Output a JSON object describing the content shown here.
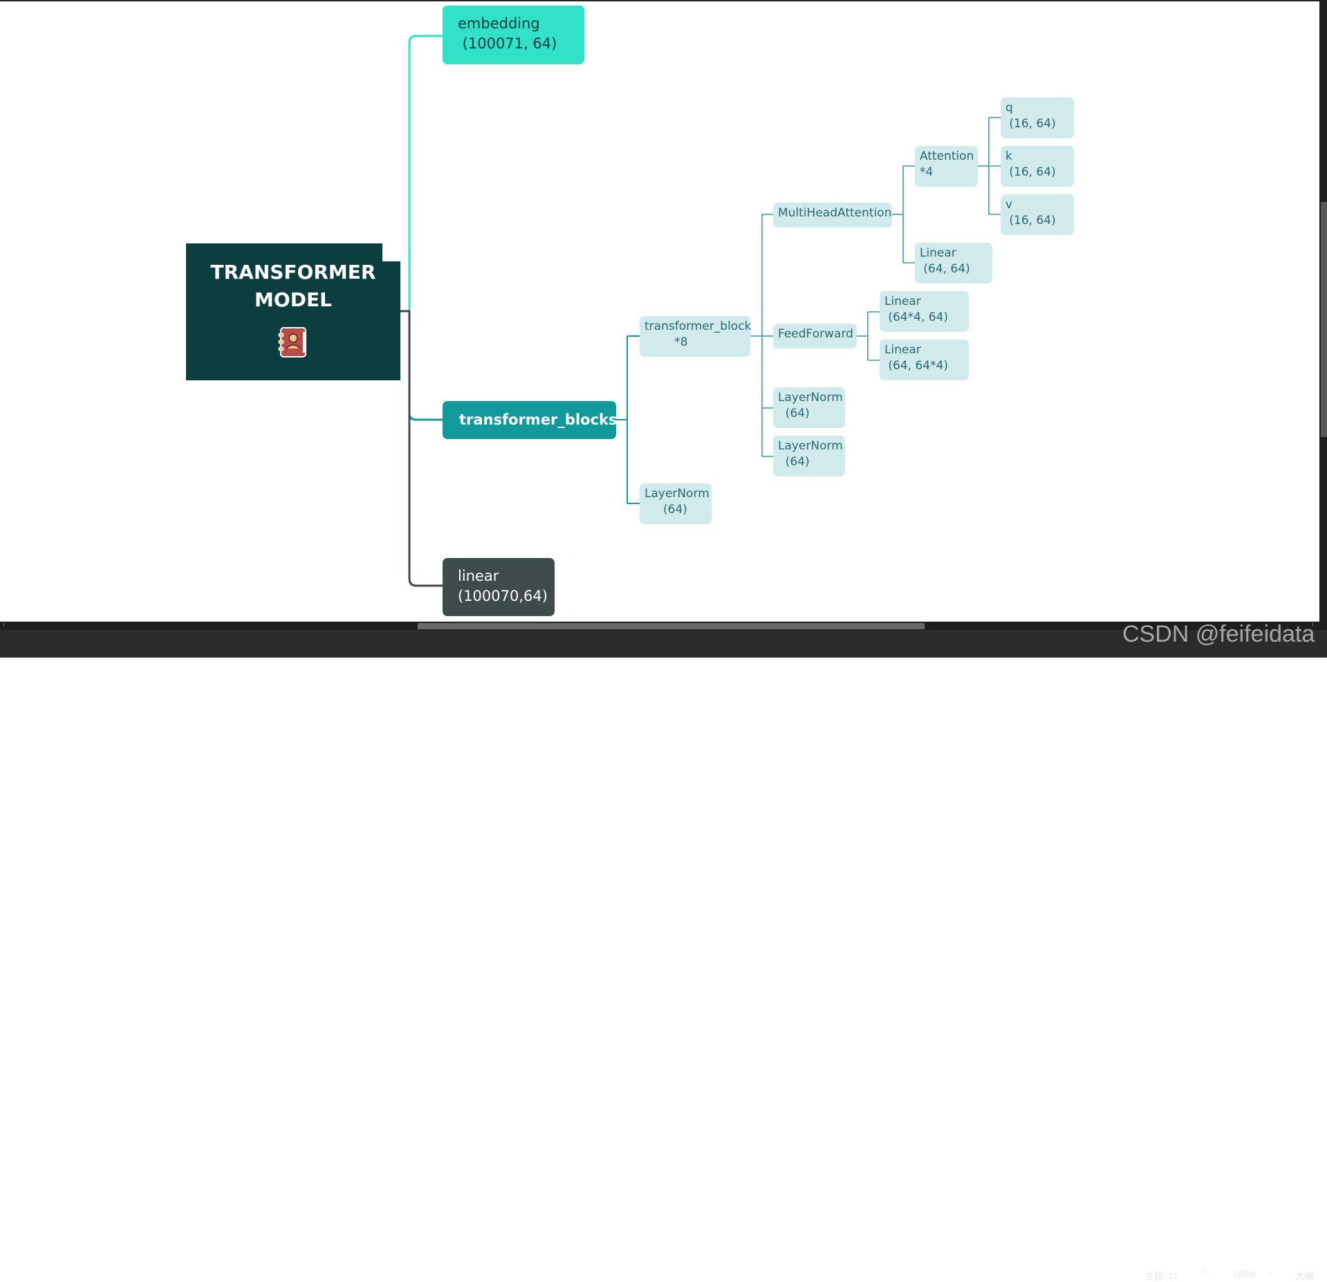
{
  "root": {
    "title": "TRANSFORMER\nMODEL",
    "icon": "address-book-icon"
  },
  "branches": {
    "embedding": {
      "label": "embedding\n (100071, 64)"
    },
    "transformer_blocks": {
      "label": "transformer_blocks"
    },
    "linear": {
      "label": "linear\n(100070,64)"
    }
  },
  "nodes": {
    "transformer_block": "transformer_block\n        *8",
    "final_layernorm": "LayerNorm\n     (64)",
    "multihead": "MultiHeadAttention",
    "feedforward": "FeedForward",
    "layernorm_1": "LayerNorm\n  (64)",
    "layernorm_2": "LayerNorm\n  (64)",
    "attention": "Attention\n*4",
    "attn_linear": "Linear\n (64, 64)",
    "ff_linear_1": "Linear\n (64*4, 64)",
    "ff_linear_2": "Linear\n (64, 64*4)",
    "q": "q\n (16, 64)",
    "k": "k\n (16, 64)",
    "v": "v\n (16, 64)"
  },
  "status": {
    "topic_count": "主题: 17",
    "zoom": "100%",
    "view_mode": "大纲"
  },
  "watermark": "CSDN @feifeidata",
  "colors": {
    "root": "#0c3e40",
    "embedding": "#31e2c9",
    "blocks": "#12999c",
    "linear": "#3f4b4b",
    "subnode": "#d1eaec",
    "connector_sub": "#3a9ea2"
  }
}
